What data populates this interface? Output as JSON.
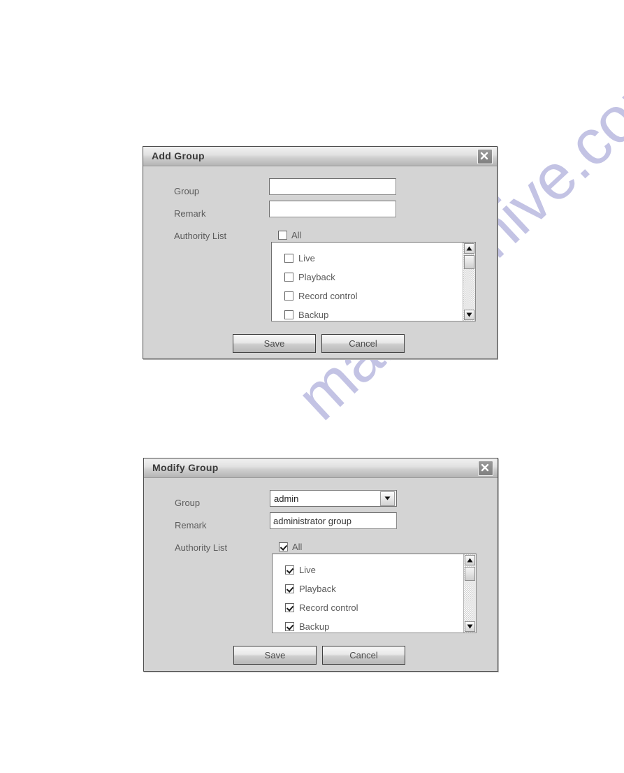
{
  "watermark": {
    "text": "manualshive.com"
  },
  "dialogs": [
    {
      "title": "Add Group",
      "close_icon": "close-icon",
      "fields": {
        "group_label": "Group",
        "group_value": "",
        "group_placeholder": "",
        "remark_label": "Remark",
        "remark_value": "",
        "remark_placeholder": "",
        "authority_label": "Authority List",
        "all_label": "All",
        "all_checked": false
      },
      "authority_items": [
        {
          "label": "Live",
          "checked": false
        },
        {
          "label": "Playback",
          "checked": false
        },
        {
          "label": "Record control",
          "checked": false
        },
        {
          "label": "Backup",
          "checked": false
        }
      ],
      "buttons": {
        "save": "Save",
        "cancel": "Cancel"
      }
    },
    {
      "title": "Modify Group",
      "close_icon": "close-icon",
      "fields": {
        "group_label": "Group",
        "group_value": "admin",
        "remark_label": "Remark",
        "remark_value": "administrator group",
        "authority_label": "Authority List",
        "all_label": "All",
        "all_checked": true
      },
      "authority_items": [
        {
          "label": "Live",
          "checked": true
        },
        {
          "label": "Playback",
          "checked": true
        },
        {
          "label": "Record control",
          "checked": true
        },
        {
          "label": "Backup",
          "checked": true
        }
      ],
      "buttons": {
        "save": "Save",
        "cancel": "Cancel"
      }
    }
  ],
  "colors": {
    "dialog_bg": "#d4d4d4",
    "titlebar_top": "#f1f1f1",
    "titlebar_bottom": "#b4b4b4",
    "label_text": "#5c5c5c",
    "watermark": "#b9b9e0"
  }
}
